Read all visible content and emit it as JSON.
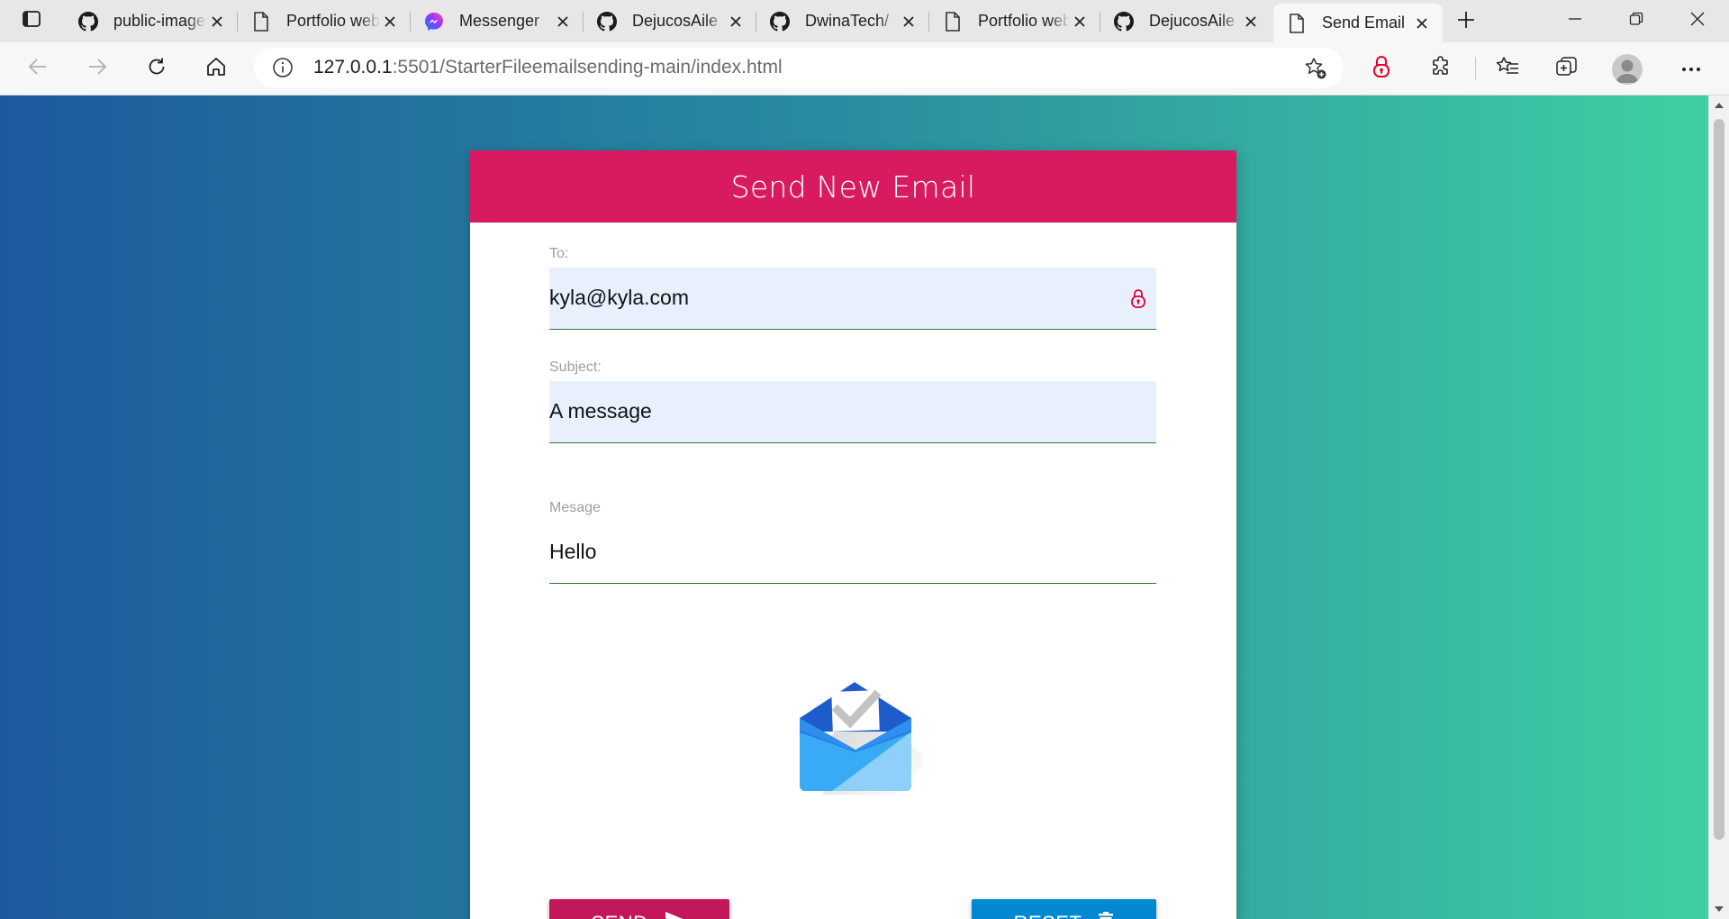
{
  "browser": {
    "tabs": [
      {
        "title": "public-images",
        "icon": "github-icon"
      },
      {
        "title": "Portfolio website",
        "icon": "page-icon"
      },
      {
        "title": "Messenger",
        "icon": "messenger-icon"
      },
      {
        "title": "DejucosAile",
        "icon": "github-icon"
      },
      {
        "title": "DwinaTech/",
        "icon": "github-icon"
      },
      {
        "title": "Portfolio website",
        "icon": "page-icon"
      },
      {
        "title": "DejucosAile",
        "icon": "github-icon"
      },
      {
        "title": "Send Email",
        "icon": "page-icon",
        "active": true
      }
    ],
    "address": {
      "host": "127.0.0.1",
      "path": ":5501/StarterFileemailsending-main/index.html"
    }
  },
  "page": {
    "title": "Send New Email",
    "to": {
      "label": "To:",
      "value": "kyla@kyla.com"
    },
    "subject": {
      "label": "Subject:",
      "value": "A message"
    },
    "message": {
      "label": "Mesage",
      "value": "Hello"
    },
    "send_label": "SEND",
    "reset_label": "RESET"
  },
  "colors": {
    "header": "#d81b60",
    "send": "#c2185b",
    "reset": "#0288d1",
    "gradient_start": "#1c5a9e",
    "gradient_end": "#3fcfa2"
  }
}
